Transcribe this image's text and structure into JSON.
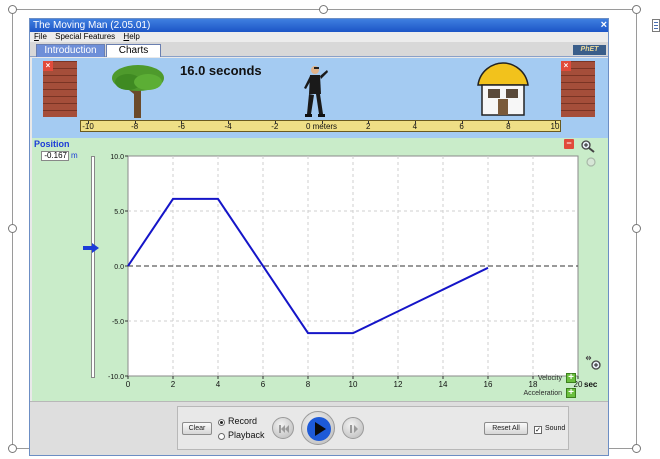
{
  "window": {
    "title": "The Moving Man (2.05.01)",
    "close_glyph": "×"
  },
  "menu": [
    {
      "hot": "F",
      "rest": "ile"
    },
    {
      "hot": "",
      "rest": "Special Features"
    },
    {
      "hot": "H",
      "rest": "elp"
    }
  ],
  "tabs": [
    {
      "label": "Introduction",
      "active": false
    },
    {
      "label": "Charts",
      "active": true
    }
  ],
  "logo_text": "PhET",
  "play_area": {
    "time_readout": "16.0 seconds",
    "wall_close_glyph": "×",
    "ruler_ticks": [
      "-10",
      "-8",
      "-6",
      "-4",
      "-2",
      "0 meters",
      "2",
      "4",
      "6",
      "8",
      "10"
    ]
  },
  "chart_panel": {
    "series_label": "Position",
    "value": "-0.167",
    "unit": "m",
    "minimize_glyph": "−",
    "velocity_label": "Velocity",
    "acceleration_label": "Acceleration",
    "plus_glyph": "+"
  },
  "chart_data": {
    "type": "line",
    "title": "",
    "xlabel": "",
    "ylabel": "",
    "x_unit_label": "sec",
    "xlim": [
      0,
      20
    ],
    "ylim": [
      -10,
      10
    ],
    "x_ticks": [
      0,
      2,
      4,
      6,
      8,
      10,
      12,
      14,
      16,
      18,
      20
    ],
    "x_tick_labels": [
      "0",
      "2",
      "4",
      "6",
      "8",
      "10",
      "12",
      "14",
      "16",
      "18",
      "20"
    ],
    "y_ticks": [
      10,
      5,
      0,
      -5,
      -10
    ],
    "y_tick_labels": [
      "10.0",
      "5.0",
      "0.0",
      "-5.0",
      "-10.0"
    ],
    "grid": true,
    "line_color": "#1515c8",
    "series": [
      {
        "x": [
          0,
          2,
          4,
          8,
          10,
          16
        ],
        "y": [
          0,
          6.1,
          6.1,
          -6.1,
          -6.1,
          -0.167
        ]
      }
    ]
  },
  "controls": {
    "clear_label": "Clear",
    "record_label": "Record",
    "playback_label": "Playback",
    "reset_label": "Reset All",
    "sound_label": "Sound",
    "sound_checked_glyph": "✓"
  },
  "colors": {
    "sky": "#a4cbf2",
    "chart_bg": "#c9ecc9",
    "plot_bg": "#ffffff",
    "accent_blue": "#1c3cd8"
  }
}
